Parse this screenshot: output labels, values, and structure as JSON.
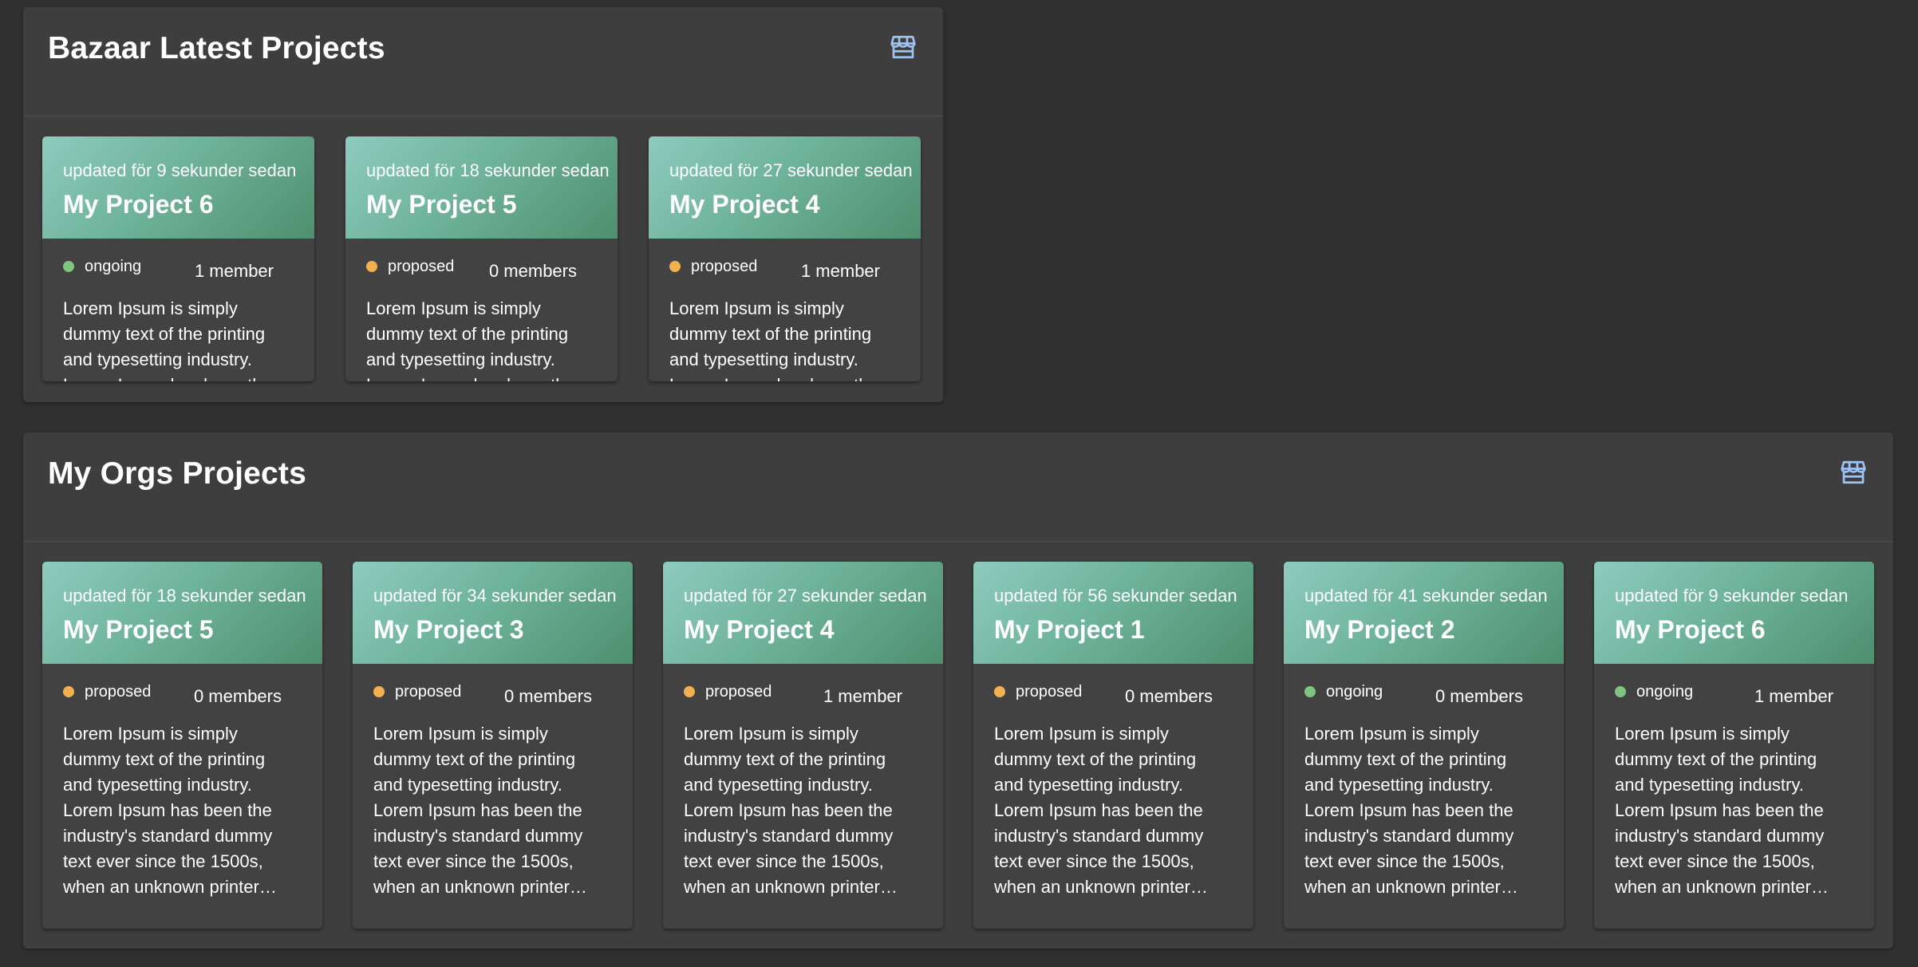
{
  "colors": {
    "background": "#303030",
    "panel": "#3e3e3e",
    "card": "#424242",
    "header_gradient_start": "#8ecbbe",
    "header_gradient_end": "#4e8f6e",
    "status_ongoing": "#7fc47f",
    "status_proposed": "#f3b04f",
    "store_icon": "#9ec3f5"
  },
  "bazaar": {
    "title": "Bazaar Latest Projects",
    "icon": "store-icon",
    "cards": [
      {
        "updated": "updated för 9 sekunder sedan",
        "name": "My Project 6",
        "status": "ongoing",
        "members": "1 member",
        "description": "Lorem Ipsum is simply dummy text of the printing and typesetting industry. Lorem Ipsum has been the industry's standard dummy text ever since the 1500s, when an unknown printer..."
      },
      {
        "updated": "updated för 18 sekunder sedan",
        "name": "My Project 5",
        "status": "proposed",
        "members": "0 members",
        "description": "Lorem Ipsum is simply dummy text of the printing and typesetting industry. Lorem Ipsum has been the industry's standard dummy text ever since the 1500s, when an unknown printer..."
      },
      {
        "updated": "updated för 27 sekunder sedan",
        "name": "My Project 4",
        "status": "proposed",
        "members": "1 member",
        "description": "Lorem Ipsum is simply dummy text of the printing and typesetting industry. Lorem Ipsum has been the industry's standard dummy text ever since the 1500s, when an unknown printer..."
      }
    ]
  },
  "orgs": {
    "title": "My Orgs Projects",
    "icon": "store-icon",
    "cards": [
      {
        "updated": "updated för 18 sekunder sedan",
        "name": "My Project 5",
        "status": "proposed",
        "members": "0 members",
        "description": "Lorem Ipsum is simply dummy text of the printing and typesetting industry. Lorem Ipsum has been the industry's standard dummy text ever since the 1500s, when an unknown printer…"
      },
      {
        "updated": "updated för 34 sekunder sedan",
        "name": "My Project 3",
        "status": "proposed",
        "members": "0 members",
        "description": "Lorem Ipsum is simply dummy text of the printing and typesetting industry. Lorem Ipsum has been the industry's standard dummy text ever since the 1500s, when an unknown printer…"
      },
      {
        "updated": "updated för 27 sekunder sedan",
        "name": "My Project 4",
        "status": "proposed",
        "members": "1 member",
        "description": "Lorem Ipsum is simply dummy text of the printing and typesetting industry. Lorem Ipsum has been the industry's standard dummy text ever since the 1500s, when an unknown printer…"
      },
      {
        "updated": "updated för 56 sekunder sedan",
        "name": "My Project 1",
        "status": "proposed",
        "members": "0 members",
        "description": "Lorem Ipsum is simply dummy text of the printing and typesetting industry. Lorem Ipsum has been the industry's standard dummy text ever since the 1500s, when an unknown printer…"
      },
      {
        "updated": "updated för 41 sekunder sedan",
        "name": "My Project 2",
        "status": "ongoing",
        "members": "0 members",
        "description": "Lorem Ipsum is simply dummy text of the printing and typesetting industry. Lorem Ipsum has been the industry's standard dummy text ever since the 1500s, when an unknown printer…"
      },
      {
        "updated": "updated för 9 sekunder sedan",
        "name": "My Project 6",
        "status": "ongoing",
        "members": "1 member",
        "description": "Lorem Ipsum is simply dummy text of the printing and typesetting industry. Lorem Ipsum has been the industry's standard dummy text ever since the 1500s, when an unknown printer…"
      }
    ]
  }
}
